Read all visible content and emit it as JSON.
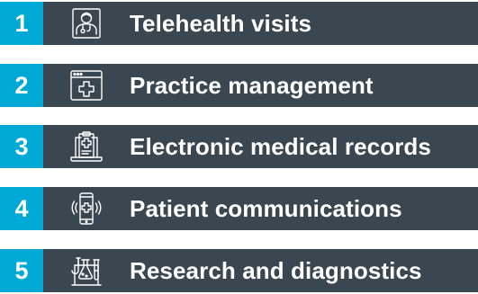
{
  "colors": {
    "row_background": "#3a4750",
    "number_badge": "#00a8d6",
    "text": "#ffffff",
    "icon_stroke": "#ffffff"
  },
  "items": [
    {
      "number": "1",
      "label": "Telehealth visits",
      "icon": "doctor-icon"
    },
    {
      "number": "2",
      "label": "Practice management",
      "icon": "browser-medical-cross-icon"
    },
    {
      "number": "3",
      "label": "Electronic medical records",
      "icon": "laptop-clipboard-icon"
    },
    {
      "number": "4",
      "label": "Patient communications",
      "icon": "smartphone-medical-cross-icon"
    },
    {
      "number": "5",
      "label": "Research and diagnostics",
      "icon": "lab-flasks-icon"
    }
  ]
}
